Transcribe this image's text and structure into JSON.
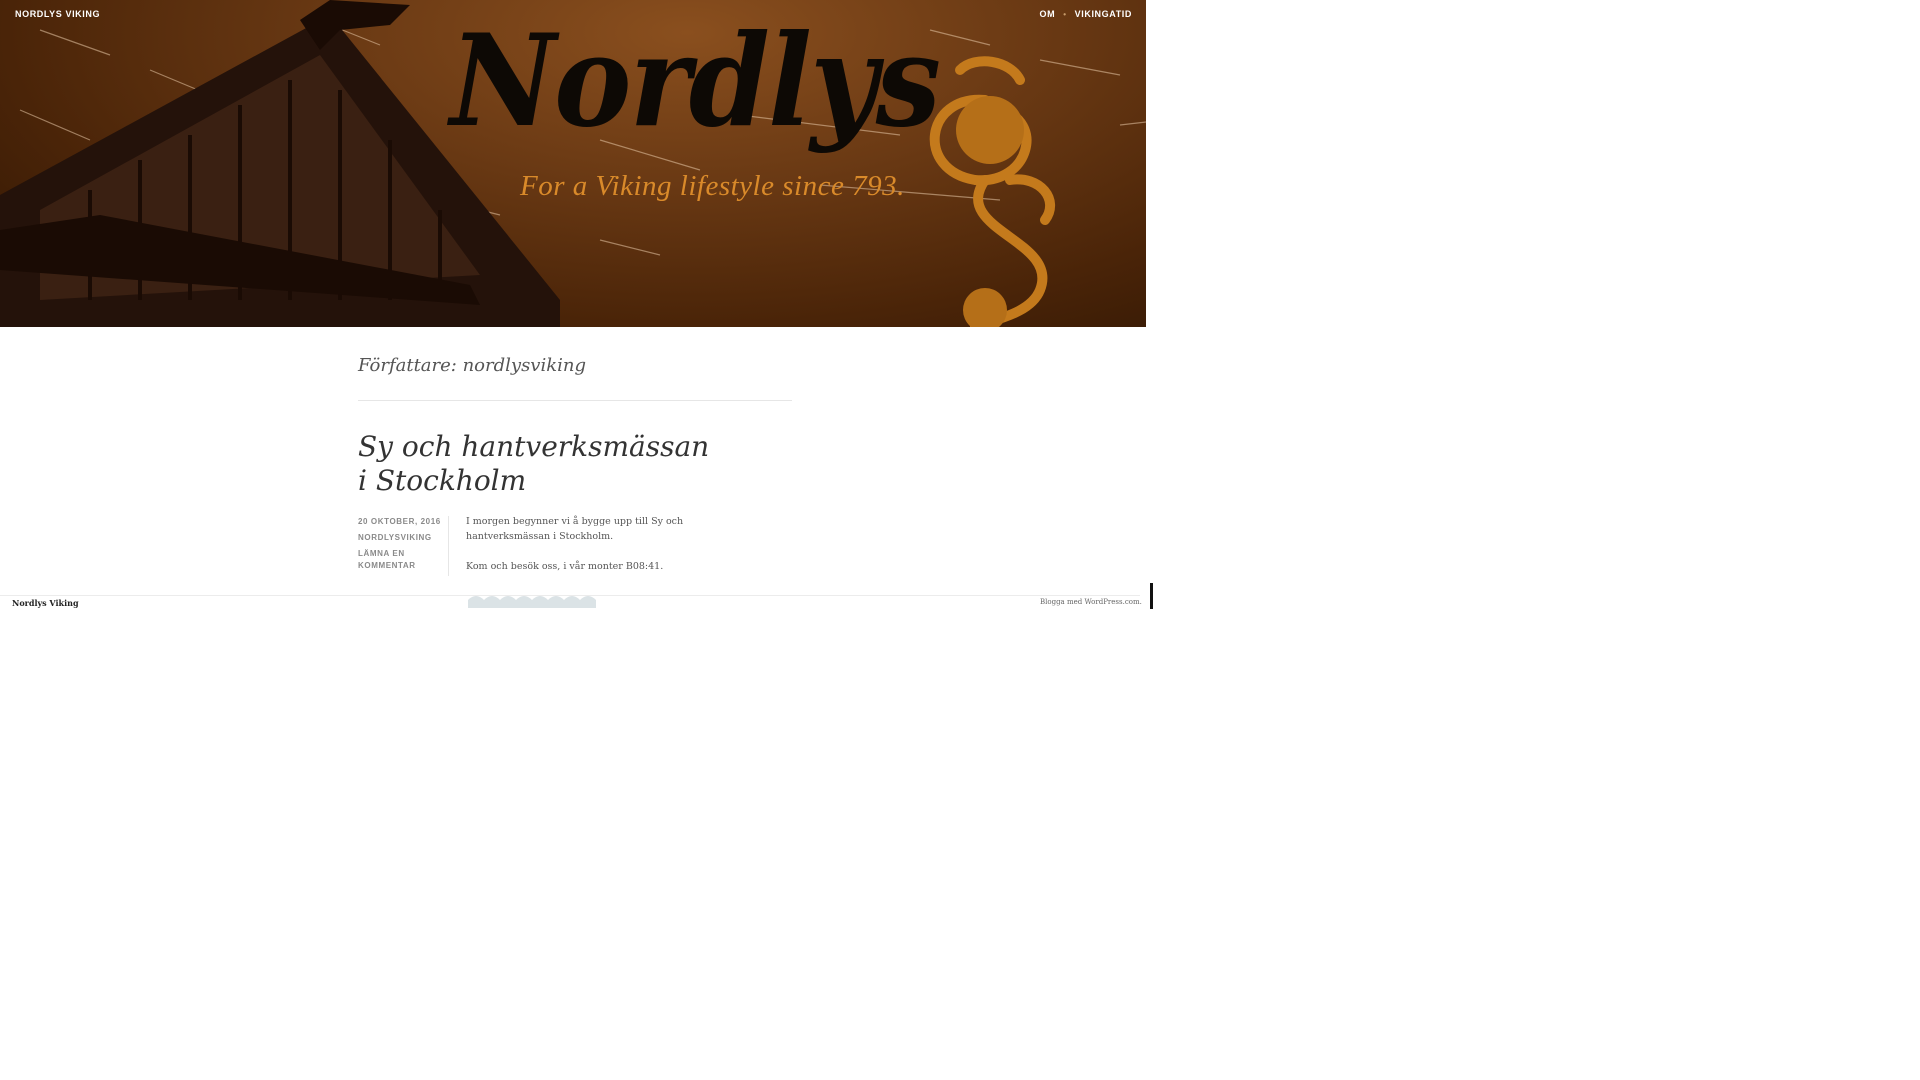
{
  "header": {
    "site_title": "NORDLYS VIKING",
    "logo_text": "Nordlys",
    "tagline": "For a Viking lifestyle since 793.",
    "menu": [
      {
        "label": "OM"
      },
      {
        "label": "VIKINGATID"
      }
    ]
  },
  "archive": {
    "title": "Författare: nordlysviking"
  },
  "post": {
    "title_line1": "Sy och hantverksmässan",
    "title_line2": "i Stockholm",
    "date": "20 OKTOBER, 2016",
    "author": "NORDLYSVIKING",
    "comment_link": "LÄMNA EN KOMMENTAR",
    "paragraphs": [
      "I morgen begynner vi å bygge upp till Sy och hantverksmässan i Stockholm.",
      "Kom och besök oss, i vår monter B08:41."
    ]
  },
  "footer": {
    "site_name": "Nordlys Viking",
    "credit": "Blogga med WordPress.com."
  },
  "colors": {
    "banner": "#6b3a14",
    "tagline": "#d98a2a",
    "accent_gold": "#c47a1c"
  }
}
